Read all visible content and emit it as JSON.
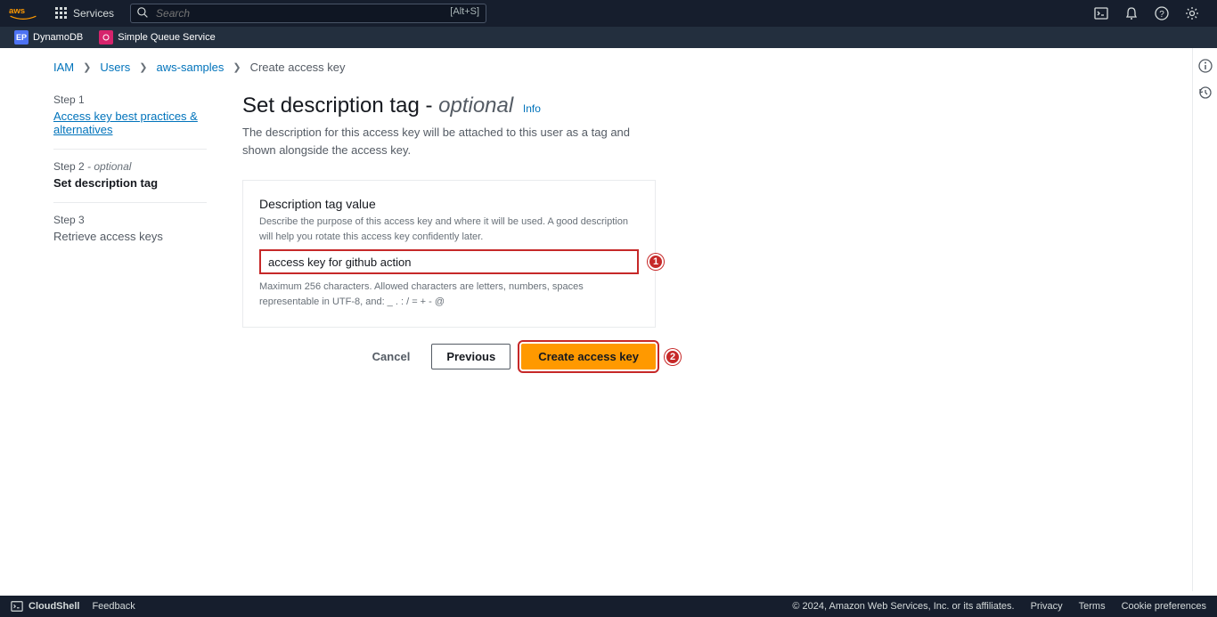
{
  "header": {
    "services_label": "Services",
    "search_placeholder": "Search",
    "search_shortcut": "[Alt+S]"
  },
  "service_bar": {
    "dynamodb": "DynamoDB",
    "sqs": "Simple Queue Service"
  },
  "breadcrumbs": {
    "iam": "IAM",
    "users": "Users",
    "user_name": "aws-samples",
    "current": "Create access key"
  },
  "steps": {
    "s1_label": "Step 1",
    "s1_title": "Access key best practices & alternatives",
    "s2_label": "Step 2",
    "s2_opt": " - optional",
    "s2_title": "Set description tag",
    "s3_label": "Step 3",
    "s3_title": "Retrieve access keys"
  },
  "page": {
    "title_main": "Set description tag",
    "title_sep": " - ",
    "title_opt": "optional",
    "info": "Info",
    "subtitle": "The description for this access key will be attached to this user as a tag and shown alongside the access key."
  },
  "form": {
    "label": "Description tag value",
    "help": "Describe the purpose of this access key and where it will be used. A good description will help you rotate this access key confidently later.",
    "value": "access key for github action",
    "note": "Maximum 256 characters. Allowed characters are letters, numbers, spaces representable in UTF-8, and: _ . : / = + - @"
  },
  "annotations": {
    "one": "1",
    "two": "2"
  },
  "actions": {
    "cancel": "Cancel",
    "previous": "Previous",
    "create": "Create access key"
  },
  "footer": {
    "cloudshell": "CloudShell",
    "feedback": "Feedback",
    "copyright": "© 2024, Amazon Web Services, Inc. or its affiliates.",
    "privacy": "Privacy",
    "terms": "Terms",
    "cookie": "Cookie preferences"
  }
}
